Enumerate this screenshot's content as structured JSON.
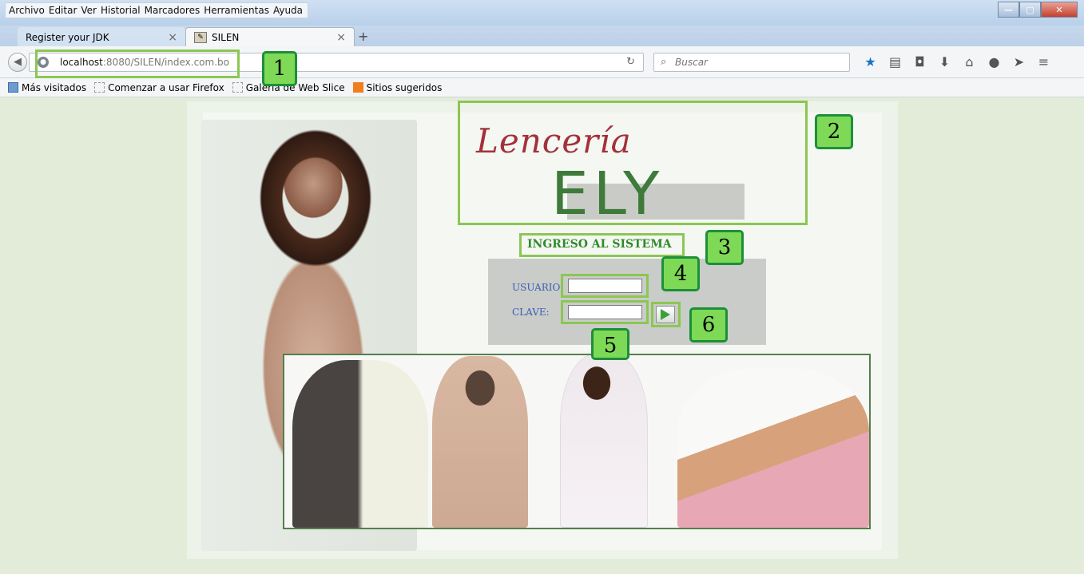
{
  "menu": [
    "Archivo",
    "Editar",
    "Ver",
    "Historial",
    "Marcadores",
    "Herramientas",
    "Ayuda"
  ],
  "tabs": [
    {
      "label": "Register your JDK",
      "close": "×"
    },
    {
      "label": "SILEN",
      "close": "×"
    }
  ],
  "new_tab": "+",
  "navbar": {
    "url_host": "localhost",
    "url_rest": ":8080/SILEN/index.com.bo",
    "search_placeholder": "Buscar"
  },
  "bookmarks": [
    "Más visitados",
    "Comenzar a usar Firefox",
    "Galería de Web Slice",
    "Sitios sugeridos"
  ],
  "page": {
    "logo_script": "Lencería",
    "logo_name": "ELY",
    "login_title": "INGRESO AL SISTEMA",
    "user_label": "USUARIO:",
    "pass_label": "CLAVE:"
  },
  "annotations": [
    "1",
    "2",
    "3",
    "4",
    "5",
    "6"
  ],
  "colors": {
    "page_bg": "#e3ecd8",
    "highlight": "#8cc653",
    "badge_fill": "#7ed957",
    "badge_border": "#1d8f3a",
    "logo_script": "#a3313b",
    "logo_name": "#3e7a3a",
    "login_title": "#2f8a2a",
    "label_blue": "#3a5fb4"
  }
}
